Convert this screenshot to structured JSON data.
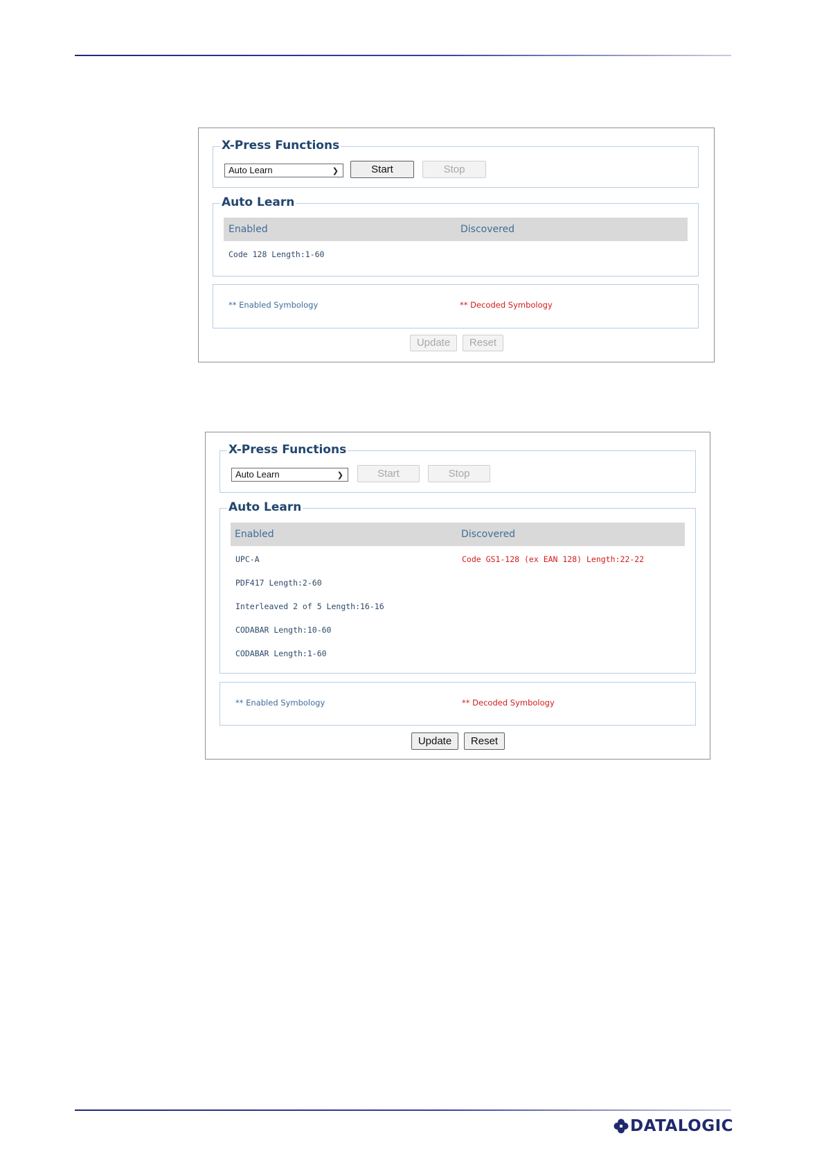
{
  "panel1": {
    "xpress_title": "X-Press Functions",
    "select_value": "Auto Learn",
    "start_label": "Start",
    "stop_label": "Stop",
    "autolearn_title": "Auto Learn",
    "col_enabled": "Enabled",
    "col_discovered": "Discovered",
    "enabled_rows": [
      "Code 128 Length:1-60"
    ],
    "legend_enabled": "** Enabled Symbology",
    "legend_decoded": "** Decoded Symbology",
    "update_label": "Update",
    "reset_label": "Reset"
  },
  "panel2": {
    "xpress_title": "X-Press Functions",
    "select_value": "Auto Learn",
    "start_label": "Start",
    "stop_label": "Stop",
    "autolearn_title": "Auto Learn",
    "col_enabled": "Enabled",
    "col_discovered": "Discovered",
    "enabled_rows": [
      "UPC-A",
      "PDF417 Length:2-60",
      "Interleaved 2 of 5 Length:16-16",
      "CODABAR Length:10-60",
      "CODABAR Length:1-60"
    ],
    "discovered_rows": [
      "Code GS1-128 (ex EAN 128) Length:22-22"
    ],
    "legend_enabled": "** Enabled Symbology",
    "legend_decoded": "** Decoded Symbology",
    "update_label": "Update",
    "reset_label": "Reset"
  },
  "footer": {
    "logo_text": "DATALOGIC",
    "logo_icon": "datalogic-clover-icon"
  },
  "colors": {
    "heading": "#22466f",
    "link_blue": "#3f6d99",
    "decoded_red": "#d11c1c",
    "rule": "#1e2a78"
  }
}
